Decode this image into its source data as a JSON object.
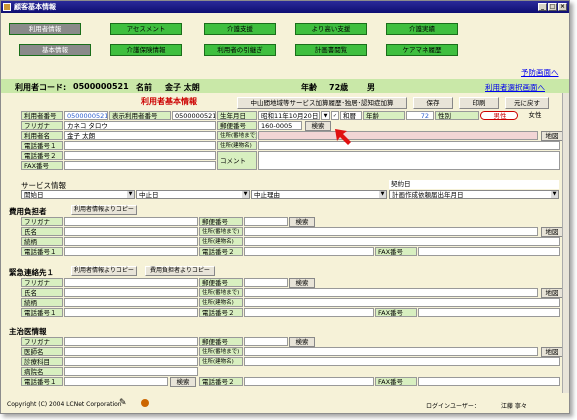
{
  "window": {
    "title": "顧客基本情報"
  },
  "nav_top": [
    "利用者情報",
    "アセスメント",
    "介護支援",
    "より高い支援",
    "介護実績"
  ],
  "nav_bottom": [
    "基本情報",
    "介護保険情報",
    "利用者の引継ぎ",
    "計画書閲覧",
    "ケアマネ履歴"
  ],
  "links": {
    "prev": "予防画面へ",
    "select": "利用者選択画面へ"
  },
  "user": {
    "code_label": "利用者コード:",
    "code": "0500000521",
    "name_label": "名前",
    "name": "金子 太朗",
    "age_label": "年齢",
    "age": "72歳",
    "sex": "男"
  },
  "section_title": "利用者基本情報",
  "buttons": {
    "history": "中山間地域等サービス加算履歴･独居･認知症加算",
    "save": "保存",
    "print": "印刷",
    "back": "元に戻す",
    "search": "検索",
    "map": "地図",
    "copy_user": "利用者情報よりコピー",
    "copy_payer": "費用負担者よりコピー"
  },
  "basic": {
    "user_no_label": "利用者番号",
    "user_no": "0500000521",
    "disp_no_label": "表示利用者番号",
    "disp_no": "0500000521",
    "birth_label": "生年月日",
    "birth": "昭和11年10月20日",
    "era": "和暦",
    "age_label": "年齢",
    "age_val": "72",
    "sex_label": "性別",
    "male": "男性",
    "female": "女性",
    "furigana_label": "フリガナ",
    "furigana": "カネコ タロウ",
    "name_label": "利用者名",
    "name": "金子 太朗",
    "zip_label": "郵便番号",
    "zip": "160-0005",
    "addr1_label": "住所(番地まで)",
    "addr2_label": "住所(建物名)",
    "tel1_label": "電話番号１",
    "tel2_label": "電話番号２",
    "fax_label": "FAX番号",
    "comment_label": "コメント"
  },
  "service": {
    "title": "サービス情報",
    "start": "開始日",
    "stop": "中止日",
    "reason": "中止理由",
    "contract": "契約日",
    "plan": "計画作成依頼届出年月日"
  },
  "payer": {
    "title": "費用負担者",
    "furigana": "フリガナ",
    "name": "氏名",
    "relation": "続柄",
    "tel1": "電話番号１",
    "zip": "郵便番号",
    "addr1": "住所(番地まで)",
    "addr2": "住所(建物名)",
    "tel2": "電話番号２",
    "fax": "FAX番号"
  },
  "emergency": {
    "title": "緊急連絡先１",
    "furigana": "フリガナ",
    "name": "氏名",
    "relation": "続柄",
    "tel1": "電話番号１",
    "zip": "郵便番号",
    "addr1": "住所(番地まで)",
    "addr2": "住所(建物名)",
    "tel2": "電話番号２",
    "fax": "FAX番号"
  },
  "doctor": {
    "title": "主治医情報",
    "furigana": "フリガナ",
    "name": "医師名",
    "dept": "診療科目",
    "hospital": "病院名",
    "tel1": "電話番号１",
    "zip": "郵便番号",
    "addr1": "住所(番地まで)",
    "addr2": "住所(建物名)",
    "tel2": "電話番号２",
    "fax": "FAX番号"
  },
  "footer": {
    "copyright": "Copyright (C) 2004 LCNet Corporation",
    "login_label": "ログインユーザー：",
    "login_user": "江藤 寧々"
  }
}
